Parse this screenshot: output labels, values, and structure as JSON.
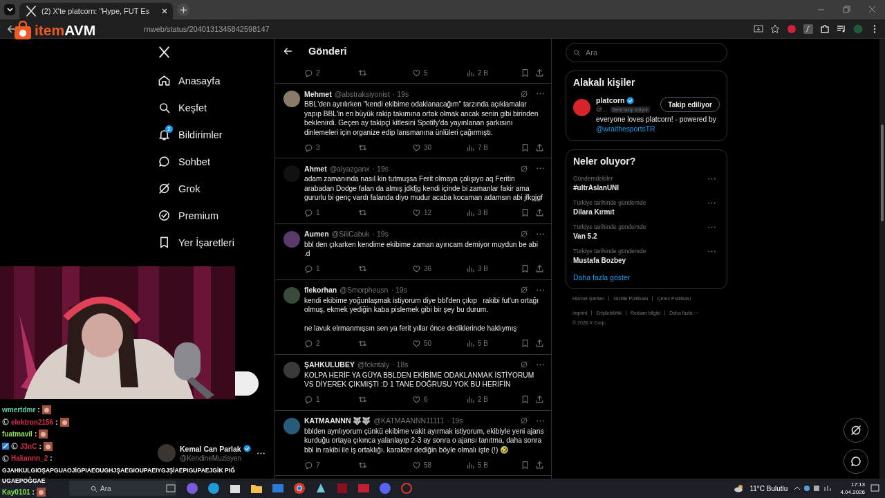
{
  "browser": {
    "tabs": [
      {
        "title": "(2) X'te platcorn: \"Hype, FUT Es",
        "selected": true
      }
    ],
    "url": "rnweb/status/2040131345842598147"
  },
  "overlay_logo": {
    "part_1": "item",
    "part_2": "AVM"
  },
  "nav": {
    "items": [
      {
        "label": "Anasayfa"
      },
      {
        "label": "Keşfet"
      },
      {
        "label": "Bildirimler",
        "badge": "2"
      },
      {
        "label": "Sohbet"
      },
      {
        "label": "Grok"
      },
      {
        "label": "Premium"
      },
      {
        "label": "Yer İşaretleri"
      }
    ],
    "account": {
      "name": "Kemal Can Parlak",
      "handle": "@KendineMuzisyen",
      "verified": true
    }
  },
  "post": {
    "header": "Gönderi",
    "top_stats": {
      "replies": "2",
      "likes": "5",
      "views": "2 B"
    },
    "replies": [
      {
        "name": "Mehmet",
        "handle": "@abstraksiyonist",
        "time": "· 19s",
        "text": "BBL'den ayrılırken \"kendi ekibime odaklanacağım\" tarzında açıklamalar yapıp BBL'in en büyük rakip takımına ortak olmak ancak senin gibi birinden beklenirdi. Geçen ay takipçi kitlesini Spotify'da yayınlanan şarkısını dinlemeleri için organize edip lansmanına ünlüleri çağırmıştı.",
        "replies": "3",
        "likes": "30",
        "views": "7 B",
        "color": "#8a7a6a"
      },
      {
        "name": "Ahmet",
        "handle": "@alyazganx",
        "time": "· 19s",
        "text": "adam zamanında nasıl kin tutmuşsa Ferit olmaya çalışıyo aq Feritin arabadan Dodge falan da almış jdkfjg kendi içinde bi zamanlar fakir ama gururlu bi genç vardı falanda diyo mudur acaba kocaman adamsın abi jfkgjgf",
        "replies": "1",
        "likes": "12",
        "views": "3 B",
        "color": "#111111"
      },
      {
        "name": "Aumen",
        "handle": "@SiliCabuk",
        "time": "· 19s",
        "text": "bbl den çıkarken kendime ekibime zaman ayırıcam demiyor muydun be abi .d",
        "replies": "1",
        "likes": "36",
        "views": "3 B",
        "color": "#5a3a6a"
      },
      {
        "name": "flekorhan",
        "handle": "@Smorpheusn",
        "time": "· 19s",
        "text": "kendi ekibime yoğunlaşmak istiyorum diye bbl'den çıkıp   rakibi fut'un ortağı olmuş, ekmek yediğin kaba pislemek gibi bir şey bu durum.\n\nne lavuk elrmanmışsın sen ya ferit yıllar önce dediklerinde haklıymış",
        "replies": "2",
        "likes": "50",
        "views": "5 B",
        "color": "#3a4a3a"
      },
      {
        "name": "ŞAHKULUBEY",
        "handle": "@fckntaly",
        "time": "· 18s",
        "text": "KOLPA HERİF YA GÜYA BBLDEN EKİBİME ODAKLANMAK İSTİYORUM VS DİYEREK ÇIKMIŞTI :D 1 TANE DOĞRUSU YOK BU HERİFİN",
        "replies": "1",
        "likes": "6",
        "views": "2 B",
        "color": "#3a3a3a"
      },
      {
        "name": "KATMAANNN 🐺🐺",
        "handle": "@KATMAANNN11111",
        "time": "· 19s",
        "text": "bblden ayrılıyorum çünkü ekibime vakit ayırmak istiyorum, ekibiyle yeni ajans kurduğu ortaya çıkınca yalanlayıp 2-3 ay sonra o ajansı tanıtma, daha sonra bbl in rakibi ile iş ortaklığı. karakter dediğin böyle olmalı işte (!) 🤣",
        "replies": "7",
        "likes": "58",
        "views": "5 B",
        "color": "#2a5a7a"
      }
    ]
  },
  "search": {
    "placeholder": "Ara"
  },
  "related": {
    "title": "Alakalı kişiler",
    "person": {
      "name": "platcorn",
      "verified": true,
      "handle": "@...",
      "follows_you": "Seni takip ediyor",
      "button": "Takip ediliyor",
      "bio": "everyone loves platcorn! - powered by",
      "bio_link": "@wraithesportsTR"
    }
  },
  "trends": {
    "title": "Neler oluyor?",
    "items": [
      {
        "context": "Gündemdekiler",
        "name": "#ultrAslanUNI"
      },
      {
        "context": "Türkiye tarihinde gündemde",
        "name": "Dilara Kırmıt"
      },
      {
        "context": "Türkiye tarihinde gündemde",
        "name": "Van 5.2"
      },
      {
        "context": "Türkiye tarihinde gündemde",
        "name": "Mustafa Bozbey"
      }
    ],
    "more": "Daha fazla göster"
  },
  "footer": {
    "links": [
      "Hizmet Şartları",
      "Gizlilik Politikası",
      "Çerez Politikası",
      "Imprint",
      "Erişilebilirlik",
      "Reklam bilgisi",
      "Daha fazla ···"
    ],
    "copyright": "© 2026 X Corp."
  },
  "chat": [
    {
      "name": "wmertdmr",
      "colon": ":",
      "color": "#5fd3a7",
      "prime": false,
      "subscriber": false,
      "emote": true
    },
    {
      "name": "elektron2156",
      "colon": ":",
      "color": "#d22a4a",
      "prime": false,
      "subscriber": true,
      "emote": true
    },
    {
      "name": "fuatmavil",
      "colon": ":",
      "color": "#8fe05a",
      "prime": false,
      "subscriber": false,
      "emote": true
    },
    {
      "name": "J3nC",
      "colon": ":",
      "color": "#d22a4a",
      "prime": true,
      "subscriber": true,
      "emote": true
    },
    {
      "name": "Hakannn_2",
      "colon": ":",
      "color": "#d22a4a",
      "prime": false,
      "subscriber": true,
      "emote": false,
      "text": "GJAHKULGIOŞAPGUAOJİGPIAEOUGHJŞAEGIOUPAEIYGJŞİAEPIGUPAEJGİK PIĞUGAEPOĞGAE"
    },
    {
      "name": "Kay0101",
      "colon": ":",
      "color": "#7fe04a",
      "prime": false,
      "subscriber": false,
      "emote": true
    }
  ],
  "taskbar": {
    "search": "Ara",
    "weather": "11°C Bulutlu",
    "time": "17:13",
    "date": "4.04.2026"
  }
}
